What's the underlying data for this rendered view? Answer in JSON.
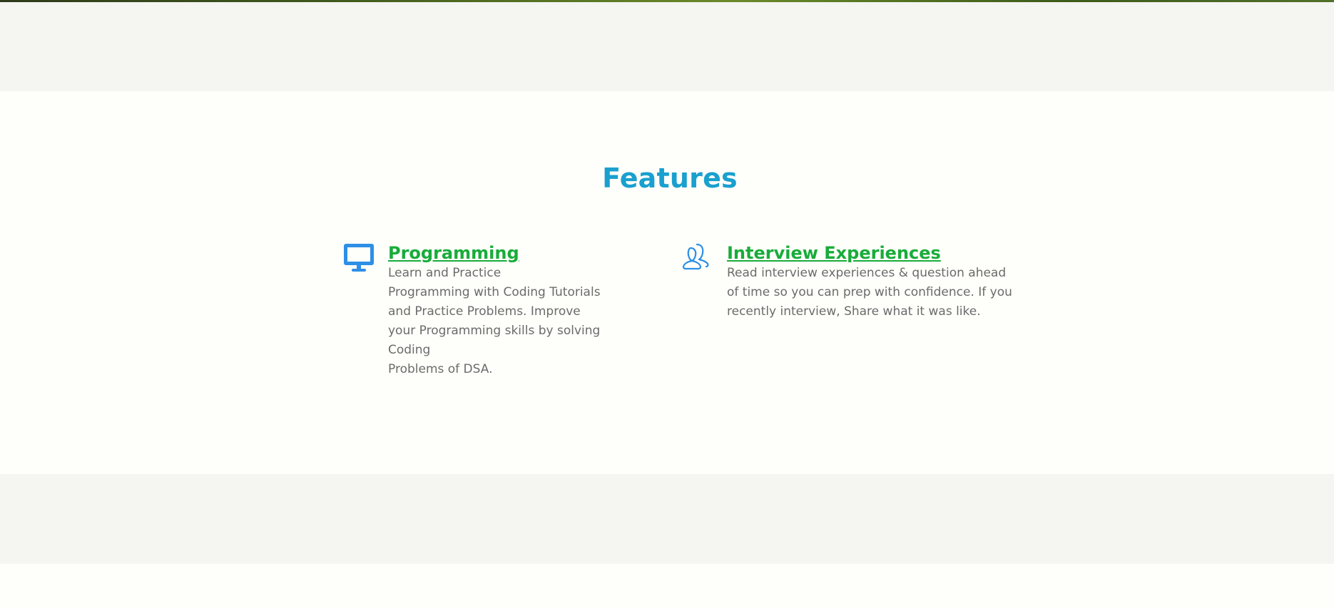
{
  "features": {
    "title": "Features",
    "items": [
      {
        "icon": "monitor-icon",
        "title": "Programming",
        "description": "Learn and Practice\nProgramming with Coding Tutorials\nand Practice Problems. Improve\nyour Programming skills by solving Coding\nProblems of DSA."
      },
      {
        "icon": "users-icon",
        "title": "Interview Experiences",
        "description": "Read interview experiences & question  ahead\nof time so you can prep with confidence. If you\nrecently interview, Share what it was like."
      }
    ]
  },
  "colors": {
    "title": "#1aa0cf",
    "feature_title": "#18ac3a",
    "icon": "#2e8fe6",
    "body_text": "#6b6b6b",
    "band": "#f5f5f2",
    "section_bg": "#fefefa"
  }
}
